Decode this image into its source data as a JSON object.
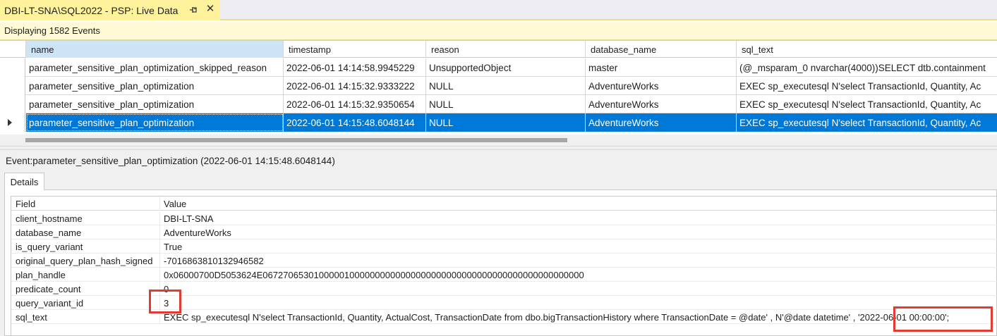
{
  "tab": {
    "title": "DBI-LT-SNA\\SQL2022 - PSP: Live Data",
    "pin_icon": "pin-icon",
    "close_icon": "close-icon"
  },
  "status": {
    "text": "Displaying 1582 Events"
  },
  "grid": {
    "columns": [
      "name",
      "timestamp",
      "reason",
      "database_name",
      "sql_text"
    ],
    "rows": [
      [
        "parameter_sensitive_plan_optimization_skipped_reason",
        "2022-06-01 14:14:58.9945229",
        "UnsupportedObject",
        "master",
        "(@_msparam_0 nvarchar(4000))SELECT dtb.containment"
      ],
      [
        "parameter_sensitive_plan_optimization",
        "2022-06-01 14:15:32.9333222",
        "NULL",
        "AdventureWorks",
        "EXEC sp_executesql    N'select TransactionId, Quantity, Ac"
      ],
      [
        "parameter_sensitive_plan_optimization",
        "2022-06-01 14:15:32.9350654",
        "NULL",
        "AdventureWorks",
        "EXEC sp_executesql    N'select TransactionId, Quantity, Ac"
      ],
      [
        "parameter_sensitive_plan_optimization",
        "2022-06-01 14:15:48.6048144",
        "NULL",
        "AdventureWorks",
        "EXEC sp_executesql    N'select TransactionId, Quantity, Ac"
      ]
    ],
    "selected_row": 3
  },
  "event": {
    "label": "Event:parameter_sensitive_plan_optimization (2022-06-01 14:15:48.6048144)",
    "tab_label": "Details"
  },
  "details": {
    "header_field": "Field",
    "header_value": "Value",
    "rows": [
      {
        "field": "client_hostname",
        "value": "DBI-LT-SNA"
      },
      {
        "field": "database_name",
        "value": "AdventureWorks"
      },
      {
        "field": "is_query_variant",
        "value": "True"
      },
      {
        "field": "original_query_plan_hash_signed",
        "value": "-7016863810132946582"
      },
      {
        "field": "plan_handle",
        "value": "0x06000700D5053624E067270653010000010000000000000000000000000000000000000000000000"
      },
      {
        "field": "predicate_count",
        "value": "0"
      },
      {
        "field": "query_variant_id",
        "value": "3"
      },
      {
        "field": "sql_text",
        "value": "EXEC sp_executesql    N'select TransactionId, Quantity, ActualCost, TransactionDate   from dbo.bigTransactionHistory   where TransactionDate = @date'   , N'@date datetime'   , '2022-06-01 00:00:00';"
      }
    ]
  },
  "colors": {
    "tab_active": "#fff29d",
    "selection": "#0078d7",
    "highlight_box": "#e03c31"
  }
}
